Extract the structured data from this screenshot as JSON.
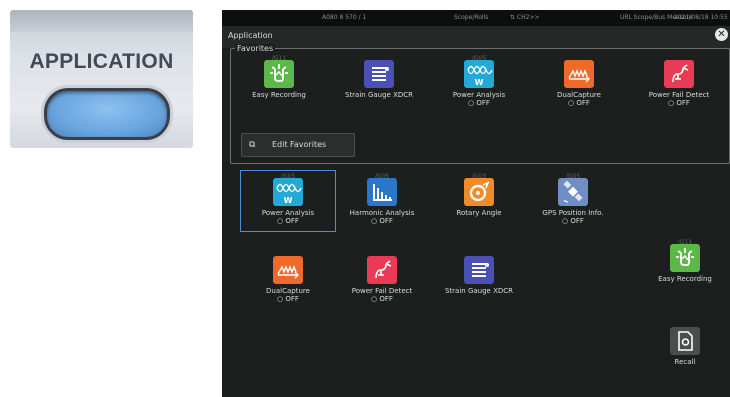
{
  "hardware": {
    "button_label": "APPLICATION"
  },
  "status_bar": {
    "left": "A080 8 570 / 1",
    "center_left": "Scope/Rolls",
    "center": "⇅ CH2>>",
    "right_date": "2021/08/18  10:55",
    "right_misc": "URL  Scope/Bus  Measure"
  },
  "window": {
    "title": "Application",
    "close_label": "✕"
  },
  "favorites": {
    "legend": "Favorites",
    "items": [
      {
        "tag": "/G11",
        "name": "Easy Recording",
        "state": "",
        "color": "green",
        "icon": "easy-recording"
      },
      {
        "tag": "",
        "name": "Strain Gauge XDCR",
        "state": "",
        "color": "purple",
        "icon": "strain-gauge"
      },
      {
        "tag": "/G05",
        "name": "Power Analysis",
        "state": "○ OFF",
        "color": "cyan",
        "icon": "power-analysis"
      },
      {
        "tag": "",
        "name": "DualCapture",
        "state": "○ OFF",
        "color": "orange",
        "icon": "dual-capture"
      },
      {
        "tag": "",
        "name": "Power Fail Detect",
        "state": "○ OFF",
        "color": "red",
        "icon": "power-fail"
      }
    ],
    "edit_label": "Edit Favorites"
  },
  "apps": [
    {
      "tag": "/G05",
      "name": "Power Analysis",
      "state": "○ OFF",
      "color": "cyan",
      "icon": "power-analysis",
      "selected": true
    },
    {
      "tag": "/G05",
      "name": "Harmonic Analysis",
      "state": "○ OFF",
      "color": "blue",
      "icon": "harmonic"
    },
    {
      "tag": "/G03",
      "name": "Rotary Angle",
      "state": "",
      "color": "amber",
      "icon": "rotary"
    },
    {
      "tag": "/G05",
      "name": "GPS Position Info.",
      "state": "○ OFF",
      "color": "steel",
      "icon": "gps"
    },
    {
      "tag": "",
      "name": "DualCapture",
      "state": "○ OFF",
      "color": "orange",
      "icon": "dual-capture"
    },
    {
      "tag": "",
      "name": "Power Fail Detect",
      "state": "○ OFF",
      "color": "red",
      "icon": "power-fail"
    },
    {
      "tag": "",
      "name": "Strain Gauge XDCR",
      "state": "",
      "color": "purple",
      "icon": "strain-gauge"
    },
    {
      "tag": "/G11",
      "name": "Easy Recording",
      "state": "",
      "color": "green",
      "icon": "easy-recording"
    },
    {
      "tag": "",
      "name": "Recall",
      "state": "",
      "color": "dgray",
      "icon": "recall"
    }
  ]
}
